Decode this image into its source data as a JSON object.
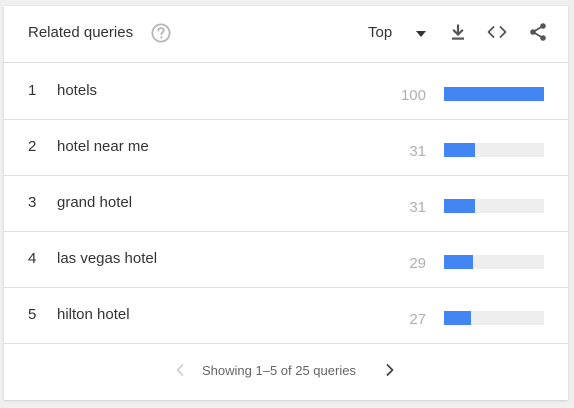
{
  "header": {
    "title": "Related queries",
    "help_icon": "help-circle-icon",
    "select_value": "Top",
    "icons": [
      "download-icon",
      "embed-code-icon",
      "share-icon"
    ]
  },
  "rows": [
    {
      "rank": "1",
      "query": "hotels",
      "value": "100",
      "level": 100
    },
    {
      "rank": "2",
      "query": "hotel near me",
      "value": "31",
      "level": 31
    },
    {
      "rank": "3",
      "query": "grand hotel",
      "value": "31",
      "level": 31
    },
    {
      "rank": "4",
      "query": "las vegas hotel",
      "value": "29",
      "level": 29
    },
    {
      "rank": "5",
      "query": "hilton hotel",
      "value": "27",
      "level": 27
    }
  ],
  "footer": {
    "pager_text": "Showing 1–5 of 25 queries"
  },
  "colors": {
    "bar": "#4285f4",
    "track": "#eeeeee",
    "text": "#333333",
    "muted": "#b0b0b0"
  }
}
